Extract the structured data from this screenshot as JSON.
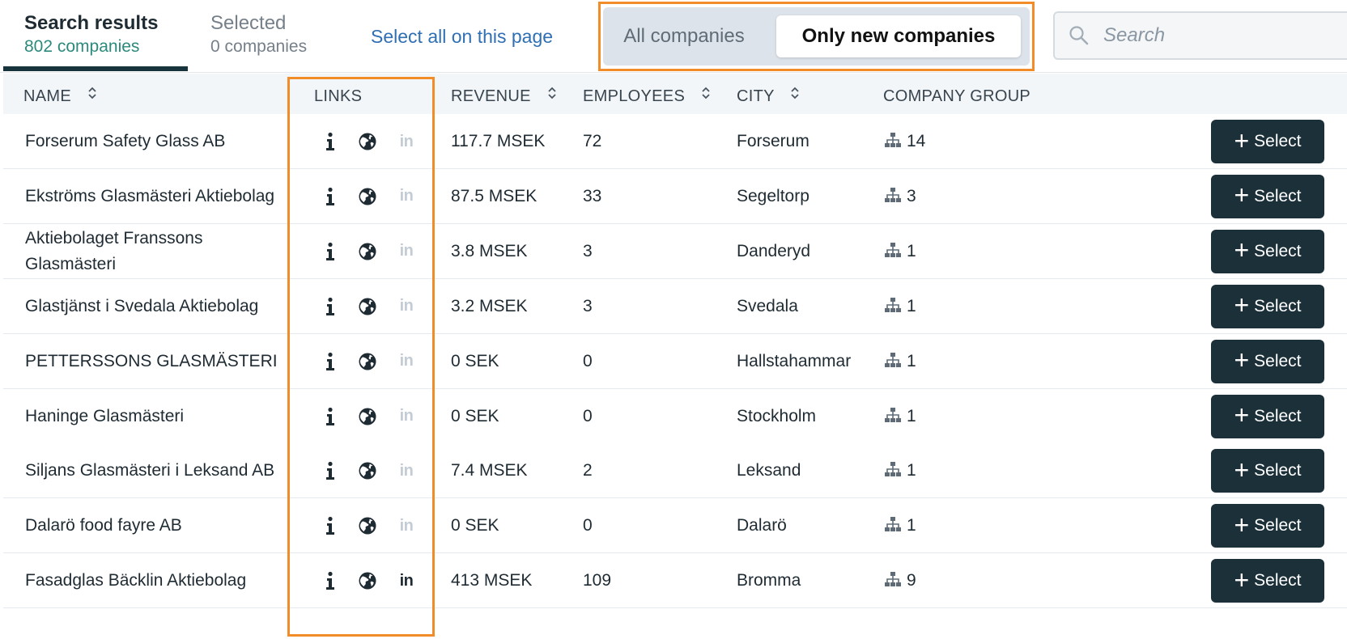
{
  "tabs": {
    "results": {
      "title": "Search results",
      "subtitle": "802 companies"
    },
    "selected": {
      "title": "Selected",
      "subtitle": "0 companies"
    }
  },
  "select_all_label": "Select all on this page",
  "toggle": {
    "all_label": "All companies",
    "new_label": "Only new companies",
    "active": "new"
  },
  "search": {
    "placeholder": "Search",
    "value": ""
  },
  "columns": {
    "name": "NAME",
    "links": "LINKS",
    "revenue": "REVENUE",
    "employees": "EMPLOYEES",
    "city": "CITY",
    "company_group": "COMPANY GROUP"
  },
  "select_button_label": "Select",
  "colors": {
    "accent": "#2c8a7c",
    "dark_button": "#1b3039",
    "highlight": "#f28c28",
    "link": "#2f6fb3"
  },
  "rows": [
    {
      "name": "Forserum Safety Glass AB",
      "revenue": "117.7 MSEK",
      "employees": "72",
      "city": "Forserum",
      "group": "14",
      "linkedin": false
    },
    {
      "name": "Ekströms Glasmästeri Aktiebolag",
      "revenue": "87.5 MSEK",
      "employees": "33",
      "city": "Segeltorp",
      "group": "3",
      "linkedin": false
    },
    {
      "name": "Aktiebolaget Franssons Glasmästeri",
      "revenue": "3.8 MSEK",
      "employees": "3",
      "city": "Danderyd",
      "group": "1",
      "linkedin": false
    },
    {
      "name": "Glastjänst i Svedala Aktiebolag",
      "revenue": "3.2 MSEK",
      "employees": "3",
      "city": "Svedala",
      "group": "1",
      "linkedin": false
    },
    {
      "name": "PETTERSSONS GLASMÄSTERI",
      "revenue": "0 SEK",
      "employees": "0",
      "city": "Hallstahammar",
      "group": "1",
      "linkedin": false
    },
    {
      "name": "Haninge Glasmästeri",
      "revenue": "0 SEK",
      "employees": "0",
      "city": "Stockholm",
      "group": "1",
      "linkedin": false
    },
    {
      "name": "Siljans Glasmästeri i Leksand AB",
      "revenue": "7.4 MSEK",
      "employees": "2",
      "city": "Leksand",
      "group": "1",
      "linkedin": false
    },
    {
      "name": "Dalarö food fayre AB",
      "revenue": "0 SEK",
      "employees": "0",
      "city": "Dalarö",
      "group": "1",
      "linkedin": false
    },
    {
      "name": "Fasadglas Bäcklin Aktiebolag",
      "revenue": "413 MSEK",
      "employees": "109",
      "city": "Bromma",
      "group": "9",
      "linkedin": true
    }
  ]
}
